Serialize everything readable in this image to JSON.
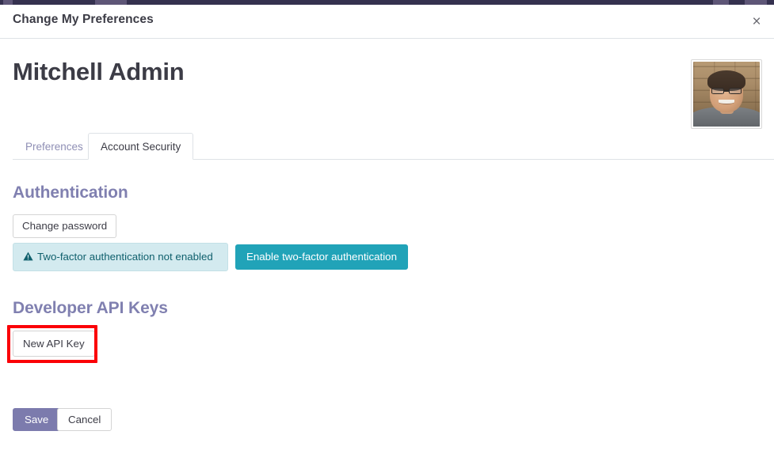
{
  "window": {
    "navbar_accent": "#35314f"
  },
  "dialog": {
    "title": "Change My Preferences",
    "close_label": "×",
    "close_icon": "close-icon"
  },
  "record": {
    "name": "Mitchell Admin",
    "avatar_alt": "Mitchell Admin profile photo"
  },
  "tabs": [
    {
      "label": "Preferences",
      "active": false
    },
    {
      "label": "Account Security",
      "active": true
    }
  ],
  "sections": {
    "authentication": {
      "title": "Authentication",
      "change_password_label": "Change password",
      "alert": {
        "icon": "warning-triangle-icon",
        "text": "Two-factor authentication not enabled"
      },
      "enable_2fa_label": "Enable two-factor authentication"
    },
    "developer_api_keys": {
      "title": "Developer API Keys",
      "new_api_key_label": "New API Key"
    }
  },
  "footer": {
    "save_label": "Save",
    "cancel_label": "Cancel"
  },
  "colors": {
    "brand_purple": "#7C7BAD",
    "heading_purple": "#8080B0",
    "info_teal": "#21A3B8",
    "alert_bg": "#D3EAEF",
    "alert_text": "#10606D",
    "annotation_red": "#FB0007",
    "tab_inactive": "#8F8FB5"
  }
}
